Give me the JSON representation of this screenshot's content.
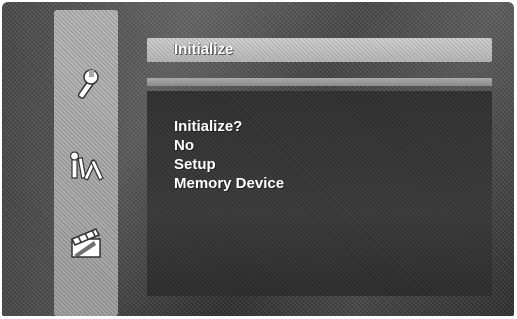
{
  "title_bar": {
    "title": "Initialize"
  },
  "side_icons": [
    {
      "name": "wrench-icon"
    },
    {
      "name": "tools-icon"
    },
    {
      "name": "clapperboard-icon"
    }
  ],
  "dialog": {
    "question": "Initialize?",
    "options": [
      "No",
      "Setup",
      "Memory Device"
    ]
  },
  "colors": {
    "screen_bg": "#3c3c3c",
    "rail_bg": "#a3a3a3",
    "title_bar_bg": "#c4c4c4",
    "text": "#ffffff"
  }
}
